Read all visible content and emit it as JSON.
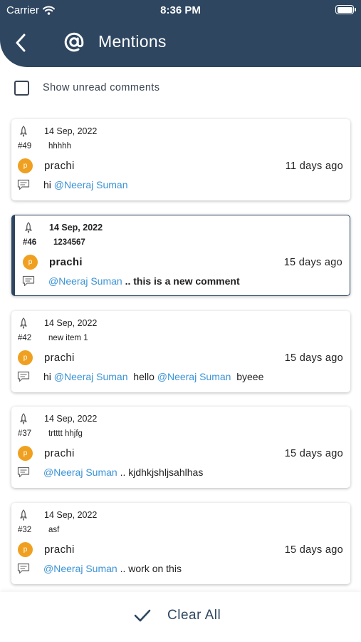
{
  "status": {
    "carrier": "Carrier",
    "time": "8:36 PM"
  },
  "header": {
    "title": "Mentions"
  },
  "filter": {
    "label": "Show unread comments",
    "checked": false
  },
  "mentions": [
    {
      "date": "14 Sep, 2022",
      "id": "#49",
      "title": "hhhhh",
      "user_initial": "p",
      "user": "prachi",
      "ago": "11 days ago",
      "comment": [
        {
          "t": "hi ",
          "m": false
        },
        {
          "t": "@Neeraj Suman",
          "m": true
        }
      ]
    },
    {
      "date": "14 Sep, 2022",
      "id": "#46",
      "title": "1234567",
      "user_initial": "p",
      "user": "prachi",
      "ago": "15 days ago",
      "comment": [
        {
          "t": "@Neeraj Suman",
          "m": true
        },
        {
          "t": " .. this is a new comment",
          "m": false
        }
      ]
    },
    {
      "date": "14 Sep, 2022",
      "id": "#42",
      "title": "new item 1",
      "user_initial": "p",
      "user": "prachi",
      "ago": "15 days ago",
      "comment": [
        {
          "t": "hi ",
          "m": false
        },
        {
          "t": "@Neeraj Suman",
          "m": true
        },
        {
          "t": "  hello ",
          "m": false
        },
        {
          "t": "@Neeraj Suman",
          "m": true
        },
        {
          "t": "  byeee",
          "m": false
        }
      ]
    },
    {
      "date": "14 Sep, 2022",
      "id": "#37",
      "title": "trtttt hhjfg",
      "user_initial": "p",
      "user": "prachi",
      "ago": "15 days ago",
      "comment": [
        {
          "t": "@Neeraj Suman",
          "m": true
        },
        {
          "t": " .. kjdhkjshljsahlhas",
          "m": false
        }
      ]
    },
    {
      "date": "14 Sep, 2022",
      "id": "#32",
      "title": "asf",
      "user_initial": "p",
      "user": "prachi",
      "ago": "15 days ago",
      "comment": [
        {
          "t": "@Neeraj Suman",
          "m": true
        },
        {
          "t": " .. work on this",
          "m": false
        }
      ]
    }
  ],
  "footer": {
    "clear_label": "Clear All"
  },
  "colors": {
    "header_bg": "#2e4660",
    "mention": "#3b93d6",
    "avatar": "#f0a020"
  }
}
